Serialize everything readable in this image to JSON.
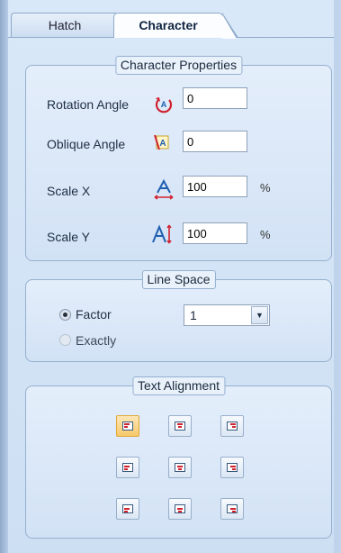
{
  "tabs": {
    "hatch": "Hatch",
    "character": "Character"
  },
  "character_properties": {
    "title": "Character Properties",
    "rotation": {
      "label": "Rotation Angle",
      "value": "0"
    },
    "oblique": {
      "label": "Oblique Angle",
      "value": "0"
    },
    "scale_x": {
      "label": "Scale X",
      "value": "100",
      "unit": "%"
    },
    "scale_y": {
      "label": "Scale Y",
      "value": "100",
      "unit": "%"
    }
  },
  "line_space": {
    "title": "Line Space",
    "factor_label": "Factor",
    "exactly_label": "Exactly",
    "selected": "Factor",
    "factor_value": "1"
  },
  "text_alignment": {
    "title": "Text Alignment",
    "selected": "top-left",
    "options": [
      "top-left",
      "top-center",
      "top-right",
      "middle-left",
      "middle-center",
      "middle-right",
      "bottom-left",
      "bottom-center",
      "bottom-right"
    ]
  },
  "colors": {
    "accent": "#f7c868",
    "icon_red": "#d0212f",
    "icon_blue": "#1f5fb0"
  }
}
